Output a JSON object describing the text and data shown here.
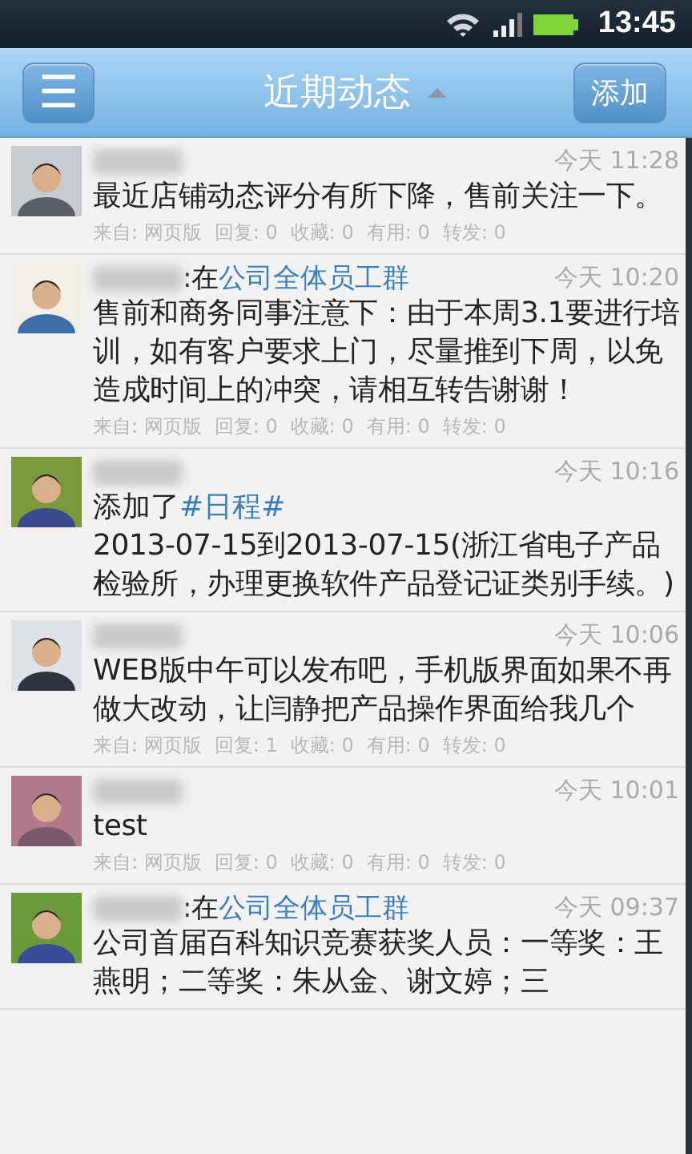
{
  "status_bar": {
    "time": "13:45"
  },
  "header": {
    "menu_button": "☰",
    "title": "近期动态",
    "add_button": "添加"
  },
  "posts": [
    {
      "avatar": {
        "kind": "picture"
      },
      "time": "今天 11:28",
      "body": "最近店铺动态评分有所下降，售前关注一下。",
      "footer": [
        "来自: 网页版",
        "回复: 0",
        "收藏: 0",
        "有用: 0",
        "转发: 0"
      ]
    },
    {
      "avatar": {
        "kind": "picture"
      },
      "group_prefix": ":在",
      "group": "公司全体员工群",
      "time": "今天 10:20",
      "body": "售前和商务同事注意下：由于本周3.1要进行培训，如有客户要求上门，尽量推到下周，以免造成时间上的冲突，请相互转告谢谢！",
      "footer": [
        "来自: 网页版",
        "回复: 0",
        "收藏: 0",
        "有用: 0",
        "转发: 0"
      ]
    },
    {
      "avatar": {
        "kind": "picture"
      },
      "time": "今天 10:16",
      "action": "添加了",
      "tag": "#日程#",
      "body": "2013-07-15到2013-07-15(浙江省电子产品检验所，办理更换软件产品登记证类别手续。)"
    },
    {
      "avatar": {
        "kind": "picture"
      },
      "time": "今天 10:06",
      "body": "WEB版中午可以发布吧，手机版界面如果不再做大改动，让闫静把产品操作界面给我几个",
      "footer": [
        "来自: 网页版",
        "回复: 1",
        "收藏: 0",
        "有用: 0",
        "转发: 0"
      ]
    },
    {
      "avatar": {
        "kind": "picture"
      },
      "time": "今天 10:01",
      "body": "test",
      "footer": [
        "来自: 网页版",
        "回复: 0",
        "收藏: 0",
        "有用: 0",
        "转发: 0"
      ]
    },
    {
      "avatar": {
        "kind": "picture"
      },
      "group_prefix": ":在",
      "group": "公司全体员工群",
      "time": "今天 09:37",
      "body": "公司首届百科知识竞赛获奖人员：一等奖：王燕明；二等奖：朱从金、谢文婷；三"
    }
  ]
}
